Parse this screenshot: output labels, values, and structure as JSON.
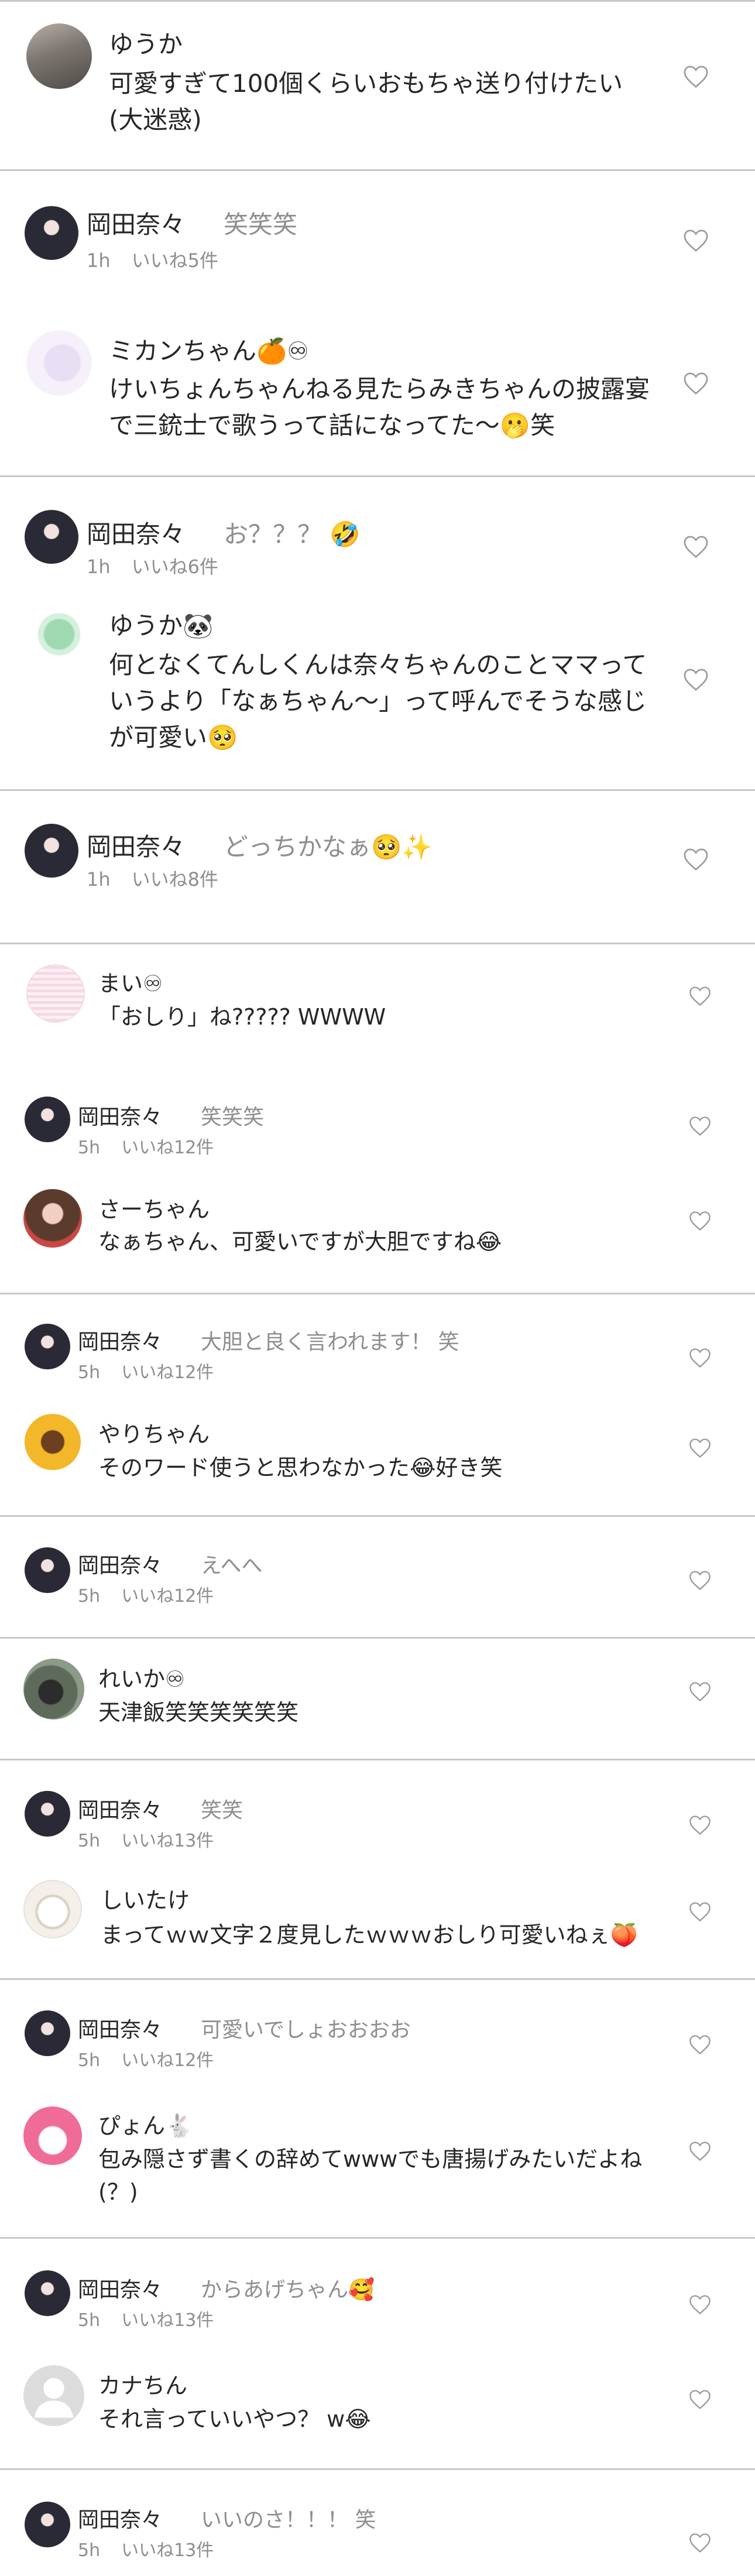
{
  "comments": [
    {
      "id": "c1",
      "name": "ゆうか",
      "text": "可愛すぎて100個くらいおもちゃ送り付けたい(大迷惑)"
    },
    {
      "id": "r1",
      "name": "岡田奈々",
      "text": "笑笑笑",
      "time": "1h",
      "likes": "いいね5件"
    },
    {
      "id": "c2",
      "name": "ミカンちゃん🍊♾",
      "text": "けいちょんちゃんねる見たらみきちゃんの披露宴で三銃士で歌うって話になってた～🫢笑"
    },
    {
      "id": "r2",
      "name": "岡田奈々",
      "text": "お？？？ 🤣",
      "time": "1h",
      "likes": "いいね6件"
    },
    {
      "id": "c3",
      "name": "ゆうか🐼",
      "text": "何となくてんしくんは奈々ちゃんのことママっていうより「なぁちゃん～」って呼んでそうな感じが可愛い🥺"
    },
    {
      "id": "r3",
      "name": "岡田奈々",
      "text": "どっちかなぁ🥺✨",
      "time": "1h",
      "likes": "いいね8件"
    },
    {
      "id": "c4",
      "name": "まい♾",
      "text": "「おしり」ね????? WWWW"
    },
    {
      "id": "r4",
      "name": "岡田奈々",
      "text": "笑笑笑",
      "time": "5h",
      "likes": "いいね12件"
    },
    {
      "id": "c5",
      "name": "さーちゃん",
      "text": "なぁちゃん、可愛いですが大胆ですね😂"
    },
    {
      "id": "r5",
      "name": "岡田奈々",
      "text": "大胆と良く言われます！ 笑",
      "time": "5h",
      "likes": "いいね12件"
    },
    {
      "id": "c6",
      "name": "やりちゃん",
      "text": "そのワード使うと思わなかった😂好き笑"
    },
    {
      "id": "r6",
      "name": "岡田奈々",
      "text": "えへへ",
      "time": "5h",
      "likes": "いいね12件"
    },
    {
      "id": "c7",
      "name": "れいか♾",
      "text": "天津飯笑笑笑笑笑笑"
    },
    {
      "id": "r7",
      "name": "岡田奈々",
      "text": "笑笑",
      "time": "5h",
      "likes": "いいね13件"
    },
    {
      "id": "c8",
      "name": "しいたけ",
      "text": "まってｗｗ文字２度見したｗｗｗおしり可愛いねぇ🍑"
    },
    {
      "id": "r8",
      "name": "岡田奈々",
      "text": "可愛いでしょおおおお",
      "time": "5h",
      "likes": "いいね12件"
    },
    {
      "id": "c9",
      "name": "ぴょん🐇",
      "text": "包み隠さず書くの辞めてwwwでも唐揚げみたいだよね(？)"
    },
    {
      "id": "r9",
      "name": "岡田奈々",
      "text": "からあげちゃん🥰",
      "time": "5h",
      "likes": "いいね13件"
    },
    {
      "id": "c10",
      "name": "カナちん",
      "text": "それ言っていいやつ？ w😂"
    },
    {
      "id": "r10",
      "name": "岡田奈々",
      "text": "いいのさ！！！ 笑",
      "time": "5h",
      "likes": "いいね13件"
    }
  ],
  "colors": {
    "text": "#262626",
    "secondary": "#8e8e8e",
    "divider": "#c8c8c8",
    "heart": "#9a9a9a"
  },
  "icons": {
    "like": "heart-outline-icon",
    "avatar": "profile-avatar"
  }
}
